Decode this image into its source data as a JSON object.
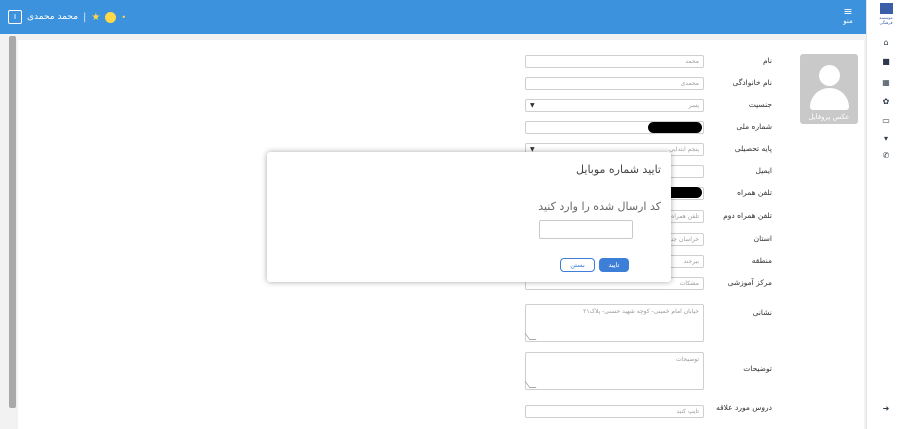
{
  "header": {
    "user_name": "محمد محمدی",
    "separator": "|",
    "menu_label": "منو"
  },
  "rail": {
    "logo_text": "موسسه فرهنگی"
  },
  "profile": {
    "avatar_caption": "عکس پروفایل"
  },
  "form": {
    "first_name": {
      "label": "نام",
      "value": "محمد"
    },
    "last_name": {
      "label": "نام خانوادگی",
      "value": "محمدی"
    },
    "gender": {
      "label": "جنسیت",
      "value": "پسر"
    },
    "national_id": {
      "label": "شماره ملی"
    },
    "grade": {
      "label": "پایه تحصیلی",
      "value": "پنجم ابتدایی"
    },
    "email": {
      "label": "ایمیل"
    },
    "mobile": {
      "label": "تلفن همراه"
    },
    "mobile2": {
      "label": "تلفن همراه دوم",
      "placeholder": "تلفن همراه دوم"
    },
    "province": {
      "label": "استان",
      "value": "خراسان جنوبی"
    },
    "region": {
      "label": "منطقه",
      "value": "بیرجند"
    },
    "center": {
      "label": "مرکز آموزشی",
      "value": "مشکات"
    },
    "address": {
      "label": "نشانی",
      "value": "خیابان امام خمینی- کوچه شهید حسنی- پلاک۲۱"
    },
    "notes": {
      "label": "توضیحات",
      "placeholder": "توضیحات"
    },
    "interests": {
      "label": "دروس مورد علاقه",
      "placeholder": "تایپ کنید"
    }
  },
  "modal": {
    "title": "تایید شماره موبایل",
    "subtitle": "کد ارسال شده را وارد کنید",
    "confirm_label": "تایید",
    "close_label": "بستن"
  },
  "colors": {
    "header": "#3d92dd",
    "primary_button": "#3d7fd6",
    "avatar_bg": "#c9c9c9"
  },
  "icons": [
    "home-icon",
    "book-icon",
    "calendar-icon",
    "gift-icon",
    "credit-card-icon",
    "cart-icon",
    "phone-icon",
    "logout-icon"
  ]
}
